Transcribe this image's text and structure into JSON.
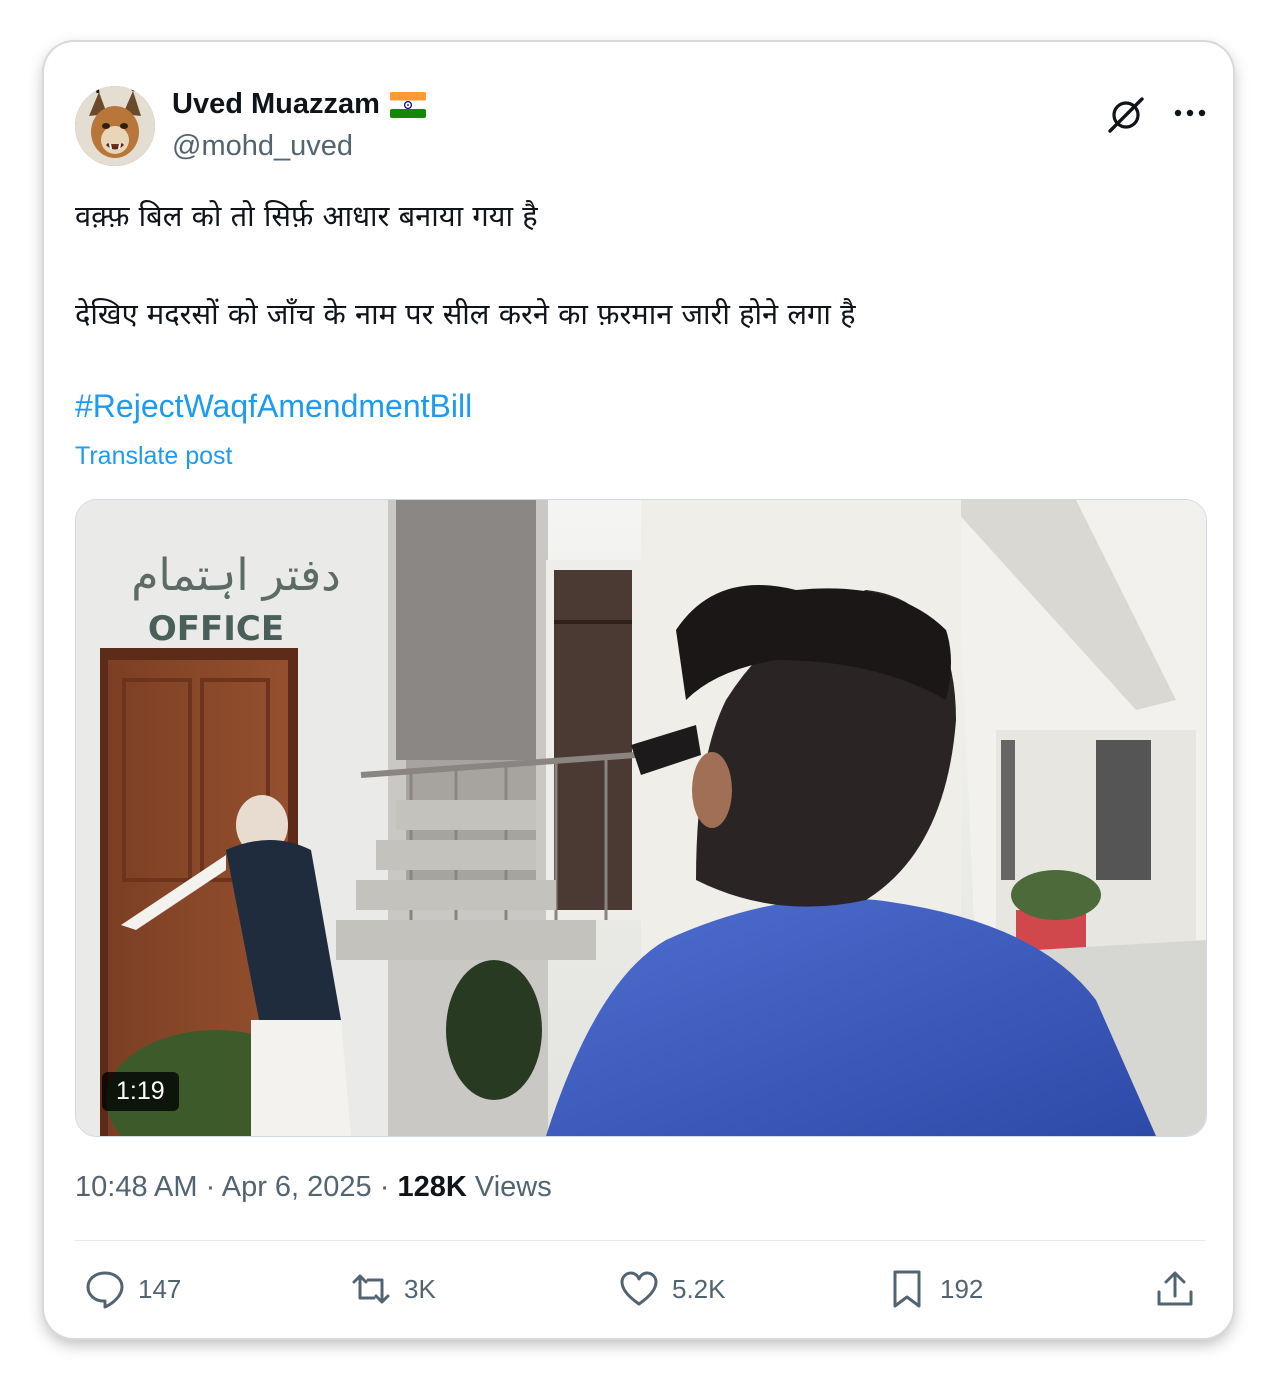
{
  "author": {
    "display_name": "Uved Muazzam",
    "flag_emoji": "🇮🇳",
    "handle": "@mohd_uved"
  },
  "post": {
    "line1": "वक़्फ़ बिल को तो सिर्फ़ आधार बनाया गया है",
    "line2": "देखिए मदरसों को जाँच के नाम पर सील करने का फ़रमान जारी होने लगा है",
    "hashtag": "#RejectWaqfAmendmentBill",
    "translate_label": "Translate post"
  },
  "media": {
    "duration": "1:19",
    "sign_text": "OFFICE",
    "sign_urdu": "دفتر اہتمام"
  },
  "meta": {
    "time": "10:48 AM",
    "separator": "·",
    "date": "Apr 6, 2025",
    "views_count": "128K",
    "views_label": "Views"
  },
  "actions": {
    "replies": "147",
    "reposts": "3K",
    "likes": "5.2K",
    "bookmarks": "192"
  },
  "colors": {
    "link": "#1d9bf0",
    "text": "#0f1419",
    "secondary": "#536471"
  },
  "icons": [
    "grok-icon",
    "more-icon",
    "reply-icon",
    "repost-icon",
    "like-icon",
    "bookmark-icon",
    "share-icon",
    "flag-icon"
  ]
}
